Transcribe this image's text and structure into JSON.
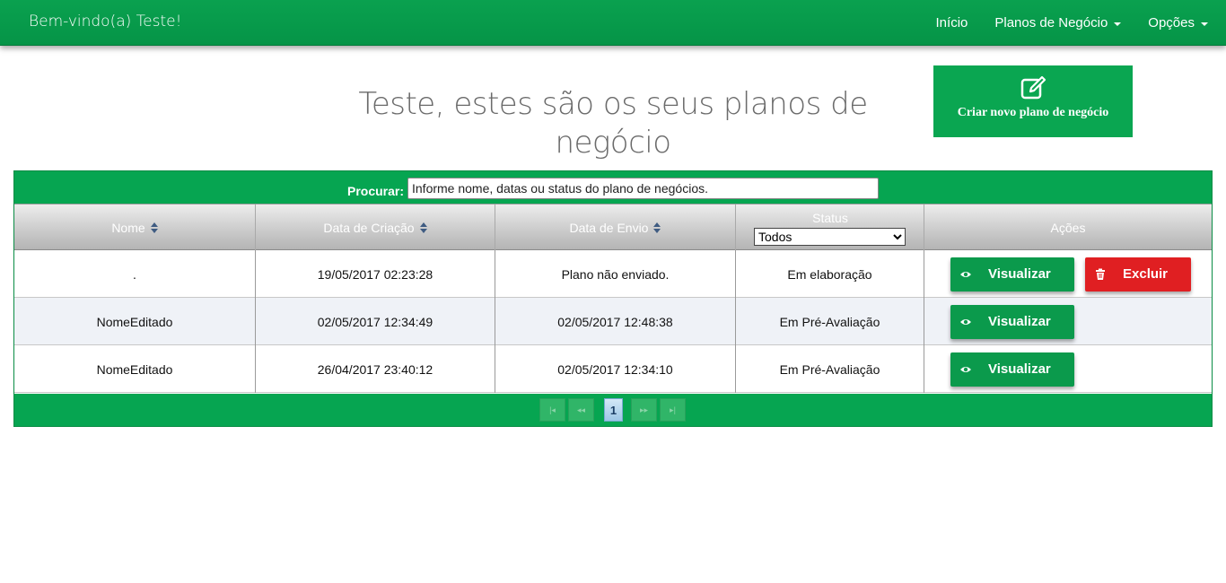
{
  "navbar": {
    "brand": "Bem-vindo(a) Teste!",
    "links": [
      "Início",
      "Planos de Negócio",
      "Opções"
    ]
  },
  "page": {
    "title": "Teste, estes são os seus planos de negócio",
    "new_plan_label": "Criar novo plano de negócio"
  },
  "search": {
    "label": "Procurar:",
    "placeholder": "Informe nome, datas ou status do plano de negócios."
  },
  "table": {
    "columns": [
      "Nome",
      "Data de Criação",
      "Data de Envio",
      "Status",
      "Ações"
    ],
    "status_filter": "Todos",
    "rows": [
      {
        "nome": ".",
        "criacao": "19/05/2017 02:23:28",
        "envio": "Plano não enviado.",
        "status": "Em elaboração"
      },
      {
        "nome": "NomeEditado",
        "criacao": "02/05/2017 12:34:49",
        "envio": "02/05/2017 12:48:38",
        "status": "Em Pré-Avaliação"
      },
      {
        "nome": "NomeEditado",
        "criacao": "26/04/2017 23:40:12",
        "envio": "02/05/2017 12:34:10",
        "status": "Em Pré-Avaliação"
      }
    ],
    "view_label": "Visualizar",
    "delete_label": "Excluir"
  },
  "pagination": {
    "first": "|◂",
    "prev": "◂◂",
    "current": "1",
    "next": "▸▸",
    "last": "▸|"
  },
  "colors": {
    "primary_green": "#06a551",
    "danger_red": "#e01f22"
  }
}
